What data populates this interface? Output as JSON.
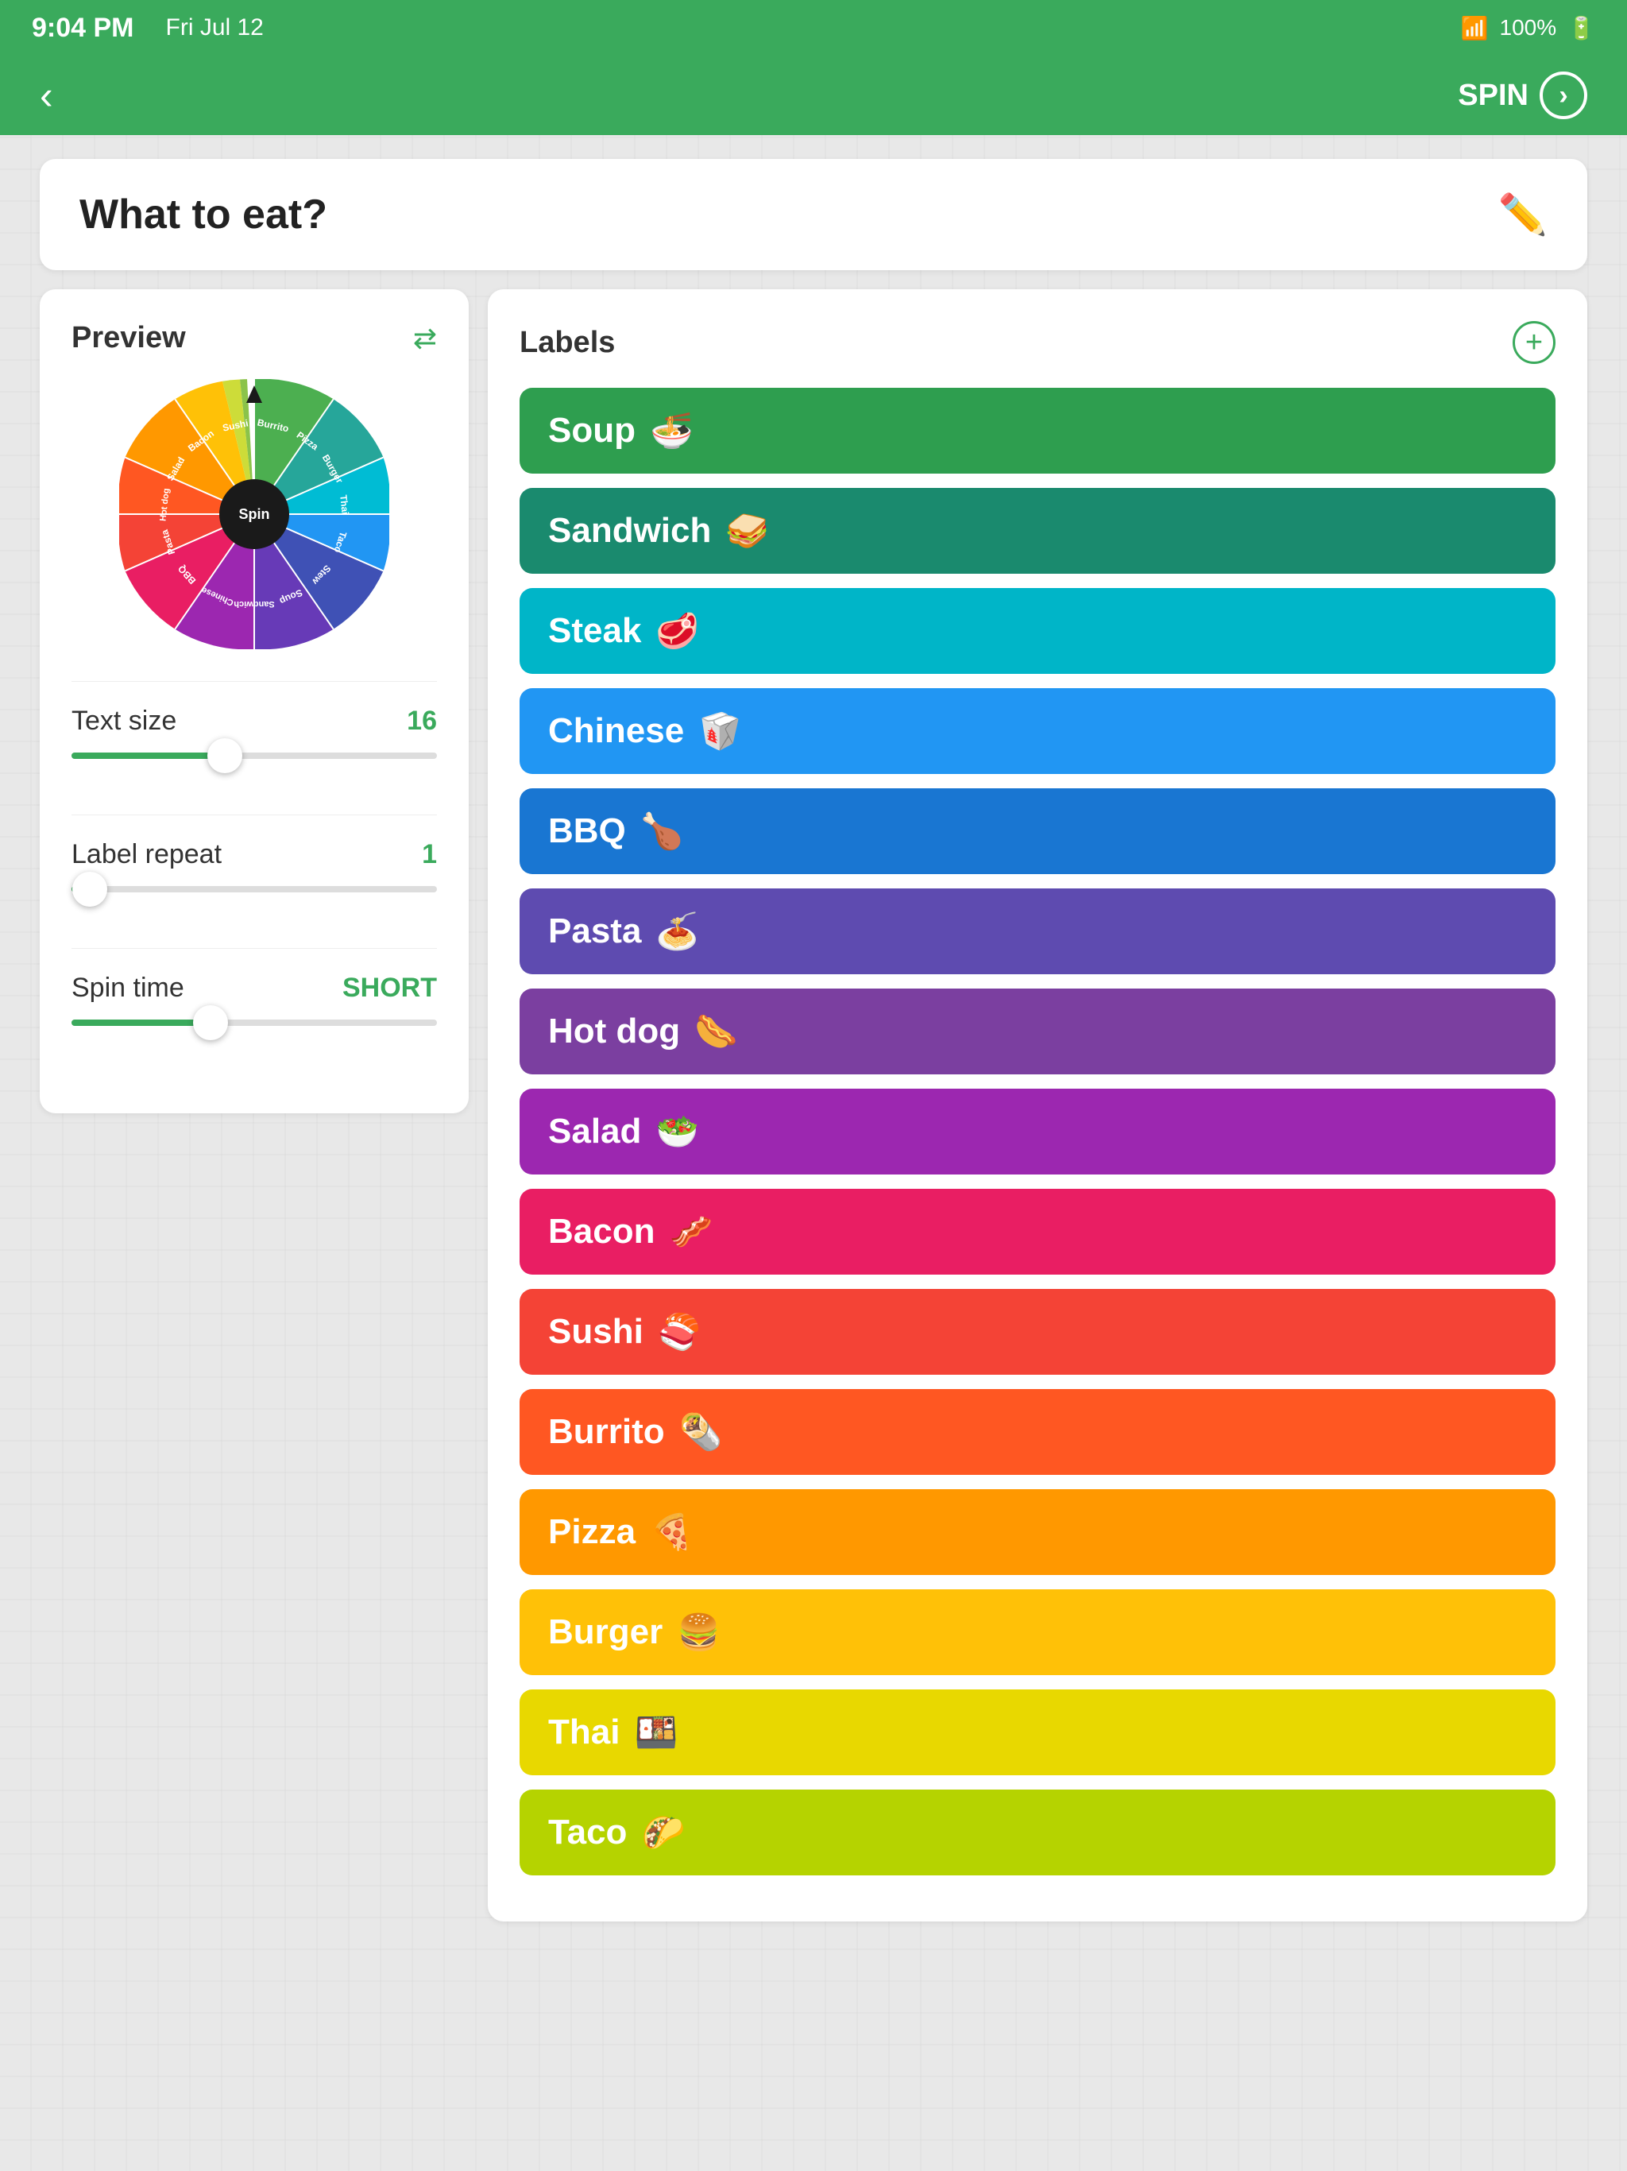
{
  "statusBar": {
    "time": "9:04 PM",
    "date": "Fri Jul 12",
    "battery": "100%"
  },
  "nav": {
    "backLabel": "‹",
    "spinLabel": "SPIN",
    "spinArrow": "›"
  },
  "titleCard": {
    "title": "What to eat?",
    "editIcon": "✏"
  },
  "leftPanel": {
    "previewLabel": "Preview",
    "shuffleIcon": "⇄",
    "spinButtonLabel": "Spin",
    "textSize": {
      "label": "Text size",
      "value": "16",
      "fillPercent": 42
    },
    "labelRepeat": {
      "label": "Label repeat",
      "value": "1",
      "fillPercent": 5
    },
    "spinTime": {
      "label": "Spin time",
      "value": "SHORT",
      "fillPercent": 38
    }
  },
  "rightPanel": {
    "labelsTitle": "Labels",
    "addIcon": "+",
    "labels": [
      {
        "text": "Soup",
        "emoji": "🍜",
        "color": "#2e9e4f"
      },
      {
        "text": "Sandwich",
        "emoji": "🥪",
        "color": "#1a8a6e"
      },
      {
        "text": "Steak",
        "emoji": "🥩",
        "color": "#00b5c8"
      },
      {
        "text": "Chinese",
        "emoji": "🥡",
        "color": "#2196f3"
      },
      {
        "text": "BBQ",
        "emoji": "🍗",
        "color": "#1976d2"
      },
      {
        "text": "Pasta",
        "emoji": "🍝",
        "color": "#5e4bb0"
      },
      {
        "text": "Hot dog",
        "emoji": "🌭",
        "color": "#7b3fa0"
      },
      {
        "text": "Salad",
        "emoji": "🥗",
        "color": "#9c27b0"
      },
      {
        "text": "Bacon",
        "emoji": "🥓",
        "color": "#e91e63"
      },
      {
        "text": "Sushi",
        "emoji": "🍣",
        "color": "#f44336"
      },
      {
        "text": "Burrito",
        "emoji": "🌯",
        "color": "#ff5722"
      },
      {
        "text": "Pizza",
        "emoji": "🍕",
        "color": "#ff9800"
      },
      {
        "text": "Burger",
        "emoji": "🍔",
        "color": "#ffc107"
      },
      {
        "text": "Thai",
        "emoji": "🍱",
        "color": "#e8d800"
      },
      {
        "text": "Taco",
        "emoji": "🌮",
        "color": "#b5d300"
      }
    ]
  },
  "wheelSegments": [
    {
      "label": "Soup",
      "color": "#4caf50",
      "emoji": "🍜"
    },
    {
      "label": "Sandwich",
      "color": "#26a69a",
      "emoji": "🥪"
    },
    {
      "label": "Steak",
      "color": "#00bcd4",
      "emoji": "🥩"
    },
    {
      "label": "Chinese",
      "color": "#2196f3",
      "emoji": "🥡"
    },
    {
      "label": "BBQ",
      "color": "#3f51b5",
      "emoji": "🍗"
    },
    {
      "label": "Pasta",
      "color": "#673ab7",
      "emoji": "🍝"
    },
    {
      "label": "Hot dog",
      "color": "#9c27b0",
      "emoji": "🌭"
    },
    {
      "label": "Salad",
      "color": "#e91e63",
      "emoji": "🥗"
    },
    {
      "label": "Bacon",
      "color": "#f44336",
      "emoji": "🥓"
    },
    {
      "label": "Sushi",
      "color": "#ff5722",
      "emoji": "🍣"
    },
    {
      "label": "Burrito",
      "color": "#ff9800",
      "emoji": "🌯"
    },
    {
      "label": "Pizza",
      "color": "#ffc107",
      "emoji": "🍕"
    },
    {
      "label": "Burger",
      "color": "#cddc39",
      "emoji": "🍔"
    },
    {
      "label": "Thai",
      "color": "#8bc34a",
      "emoji": "🍱"
    },
    {
      "label": "Taco",
      "color": "#4caf50",
      "emoji": "🌮"
    }
  ]
}
